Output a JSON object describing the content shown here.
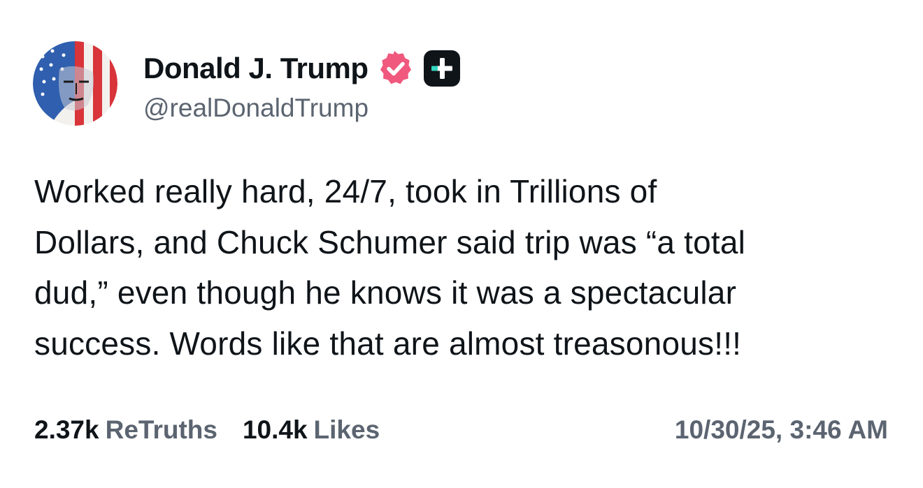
{
  "author": {
    "display_name": "Donald J. Trump",
    "handle": "@realDonaldTrump",
    "avatar_icon": "flag-portrait-avatar",
    "verified_icon": "verified-badge-icon",
    "plus_icon": "truth-plus-badge-icon"
  },
  "post": {
    "lines": [
      "Worked really hard, 24/7, took in Trillions of",
      "Dollars, and Chuck Schumer said trip was “a total",
      "dud,” even though he knows it was a spectacular",
      "success. Words like that are almost treasonous!!!"
    ]
  },
  "stats": {
    "retruths_count": "2.37k",
    "retruths_label": "ReTruths",
    "likes_count": "10.4k",
    "likes_label": "Likes"
  },
  "timestamp": "10/30/25, 3:46 AM",
  "colors": {
    "text_primary": "#0f1419",
    "text_secondary": "#5b6470",
    "verified_pink": "#f0587d",
    "plus_badge_bg": "#0f1419",
    "plus_badge_accent": "#33d6c0"
  }
}
